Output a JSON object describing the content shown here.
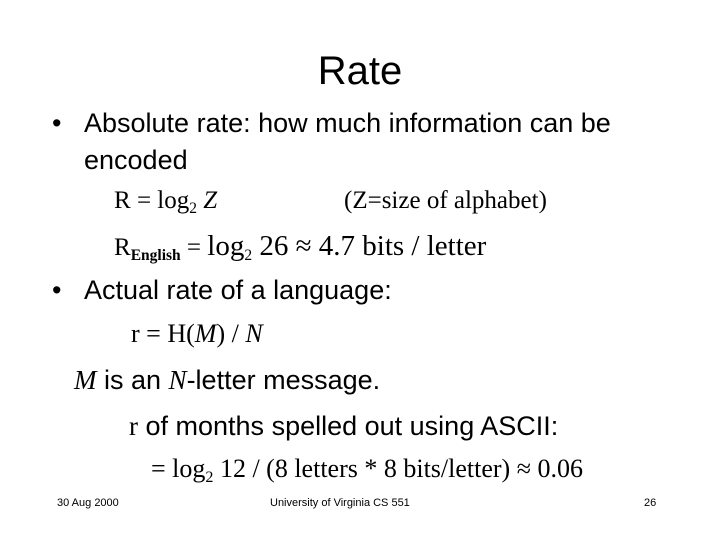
{
  "slide": {
    "title": "Rate",
    "bullets": [
      {
        "marker": "•",
        "text": "Absolute rate: how much information can be encoded"
      },
      {
        "marker": "•",
        "text": "Actual rate of a language:"
      }
    ],
    "equations": {
      "abs_rate_lhs": "R",
      "abs_rate_eq": " = log",
      "abs_rate_base": "2",
      "abs_rate_rhs": " Z",
      "abs_rate_note": "(Z=size of alphabet)",
      "english_lhs": "R",
      "english_sub": "English",
      "english_eq": " =  ",
      "english_log": "log",
      "english_base": "2",
      "english_rhs": " 26 ≈ 4.7 bits / letter",
      "actual_rate": "r = H(",
      "actual_rate_m": "M",
      "actual_rate_mid": ") / ",
      "actual_rate_n": "N",
      "message_m": "M",
      "message_mid": " is an ",
      "message_n": "N",
      "message_end": "-letter message.",
      "months_r": "r",
      "months_text": " of months spelled out using ASCII:",
      "final_eq": "= log",
      "final_base": "2",
      "final_rhs": " 12 / (8 letters * 8 bits/letter) ≈ 0.06"
    }
  },
  "footer": {
    "date": "30 Aug 2000",
    "course": "University of Virginia CS 551",
    "page": "26"
  }
}
